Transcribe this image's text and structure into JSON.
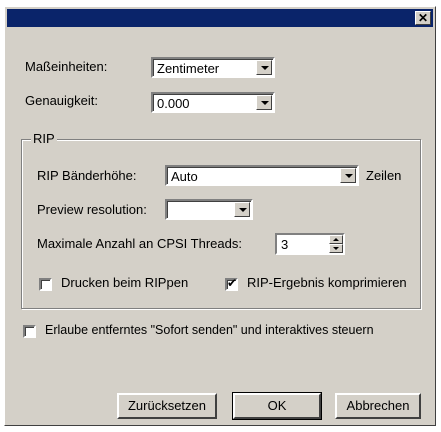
{
  "titlebar": {
    "close_glyph": "✕"
  },
  "units": {
    "label": "Maßeinheiten:",
    "value": "Zentimeter"
  },
  "precision": {
    "label": "Genauigkeit:",
    "value": "0.000"
  },
  "rip": {
    "group_label": "RIP",
    "band_height": {
      "label": "RIP Bänderhöhe:",
      "value": "Auto",
      "suffix": "Zeilen"
    },
    "preview": {
      "label": "Preview resolution:",
      "value": ""
    },
    "threads": {
      "label": "Maximale Anzahl an CPSI Threads:",
      "value": "3"
    },
    "print_while_rip": {
      "label": "Drucken beim RIPpen",
      "checked": false
    },
    "compress": {
      "label": "RIP-Ergebnis komprimieren",
      "checked": true
    }
  },
  "remote": {
    "label": "Erlaube entferntes \"Sofort senden\" und interaktives steuern",
    "checked": false
  },
  "buttons": {
    "reset": "Zurücksetzen",
    "ok": "OK",
    "cancel": "Abbrechen"
  }
}
